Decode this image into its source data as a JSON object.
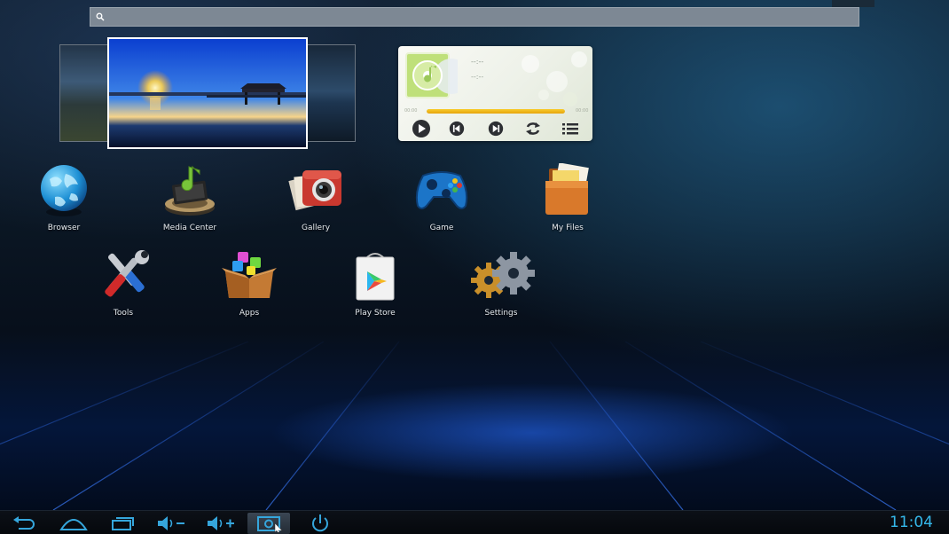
{
  "search": {
    "placeholder": "",
    "icon": "search-icon"
  },
  "music_player": {
    "track_title": "--:--",
    "track_time": "--:--",
    "elapsed": "00:00",
    "duration": "00:00",
    "progress_fraction": 1.0,
    "accent_color": "#f2b81a",
    "controls": [
      "play-icon",
      "previous-icon",
      "next-icon",
      "repeat-icon",
      "playlist-icon"
    ]
  },
  "apps": [
    {
      "label": "Browser",
      "icon": "globe-icon"
    },
    {
      "label": "Media Center",
      "icon": "media-center-icon"
    },
    {
      "label": "Gallery",
      "icon": "camera-icon"
    },
    {
      "label": "Game",
      "icon": "gamepad-icon"
    },
    {
      "label": "My Files",
      "icon": "folder-icon"
    },
    {
      "label": "Tools",
      "icon": "tools-icon"
    },
    {
      "label": "Apps",
      "icon": "box-icon"
    },
    {
      "label": "Play Store",
      "icon": "play-store-icon"
    },
    {
      "label": "Settings",
      "icon": "gears-icon"
    }
  ],
  "navbar": {
    "buttons": [
      "back-icon",
      "home-icon",
      "recent-apps-icon",
      "volume-down-icon",
      "volume-up-icon",
      "screenshot-icon",
      "power-icon"
    ],
    "active_button": "screenshot-icon",
    "clock": "11:04",
    "clock_color": "#35b8ea"
  }
}
